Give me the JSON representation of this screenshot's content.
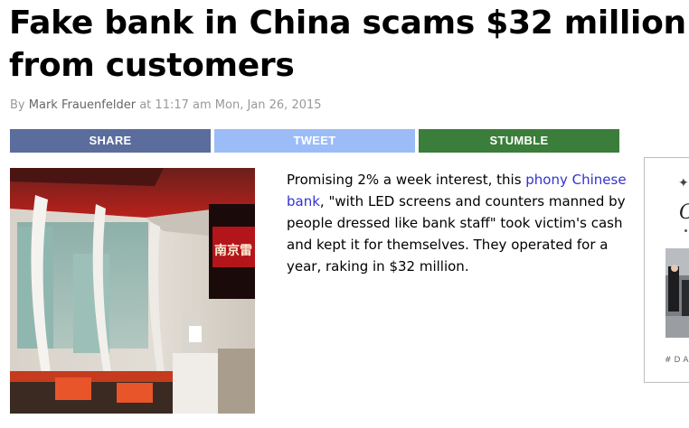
{
  "article": {
    "headline": "Fake bank in China scams $32 million from customers",
    "byline": {
      "prefix": "By",
      "author": "Mark Frauenfelder",
      "at": "at",
      "time": "11:17 am",
      "date": "Mon, Jan 26, 2015"
    },
    "body": {
      "part1": "Promising 2% a week interest, this ",
      "link_text": "phony Chinese bank",
      "part2": ", \"with LED screens and counters manned by people dressed like bank staff\" took victim's cash and kept it for themselves. They operated for a year, raking in $32 million."
    },
    "photo": {
      "icon": "bank-counter-photo",
      "sign_text": "南京雷"
    }
  },
  "share_bar": {
    "share_label": "SHARE",
    "tweet_label": "TWEET",
    "stumble_label": "STUMBLE"
  },
  "ad": {
    "logo_letter": "C",
    "tag": "#DA"
  },
  "colors": {
    "share": "#5a6d9c",
    "tweet": "#9cbcf7",
    "stumble": "#3b7d3a",
    "link": "#3333cc"
  }
}
